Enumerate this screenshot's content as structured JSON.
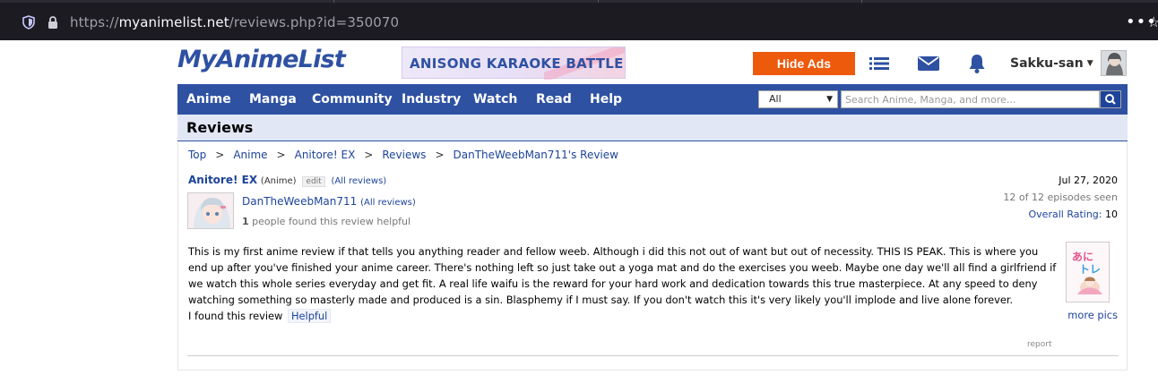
{
  "browser": {
    "url_scheme": "https://",
    "url_host": "myanimelist.net",
    "url_path": "/reviews.php?id=350070"
  },
  "header": {
    "logo_text": "MyAnimeList",
    "banner_text": "ANISONG KARAOKE BATTLE",
    "hide_ads_label": "Hide Ads",
    "username": "Sakku-san"
  },
  "nav": {
    "items": [
      "Anime",
      "Manga",
      "Community",
      "Industry",
      "Watch",
      "Read",
      "Help"
    ],
    "search_category": "All",
    "search_placeholder": "Search Anime, Manga, and more..."
  },
  "page": {
    "title": "Reviews",
    "breadcrumb": [
      "Top",
      "Anime",
      "Anitore! EX",
      "Reviews",
      "DanTheWeebMan711's Review"
    ],
    "breadcrumb_sep": ">"
  },
  "review": {
    "anime_title": "Anitore! EX",
    "anime_type": "(Anime)",
    "edit_label": "edit",
    "all_reviews_label": "(All reviews)",
    "reviewer_name": "DanTheWeebMan711",
    "reviewer_all_reviews": "(All reviews)",
    "helpful_count": "1",
    "helpful_suffix": "people found this review helpful",
    "date": "Jul 27, 2020",
    "episodes_seen": "12 of 12 episodes seen",
    "overall_label": "Overall Rating:",
    "overall_value": "10",
    "body": "This is my first anime review if that tells you anything reader and fellow weeb. Although i did this not out of want but out of necessity. THIS IS PEAK. This is where you end up after you've finished your anime career. There's nothing left so just take out a yoga mat and do the exercises you weeb. Maybe one day we'll all find a girlfriend if we watch this whole series everyday and get fit. A real life waifu is the reward for your hard work and dedication towards this true masterpiece. At any speed to deny watching something so masterly made and produced is a sin. Blasphemy if I must say. If you don't watch this it's very likely you'll implode and live alone forever.",
    "found_text": "I found this review",
    "helpful_button": "Helpful",
    "more_pics": "more pics",
    "report": "report"
  },
  "colors": {
    "brand_blue": "#2e51a2",
    "link_blue": "#1c439b",
    "hide_ads_orange": "#ee5a0c",
    "header_bg": "#e1e7f5"
  }
}
